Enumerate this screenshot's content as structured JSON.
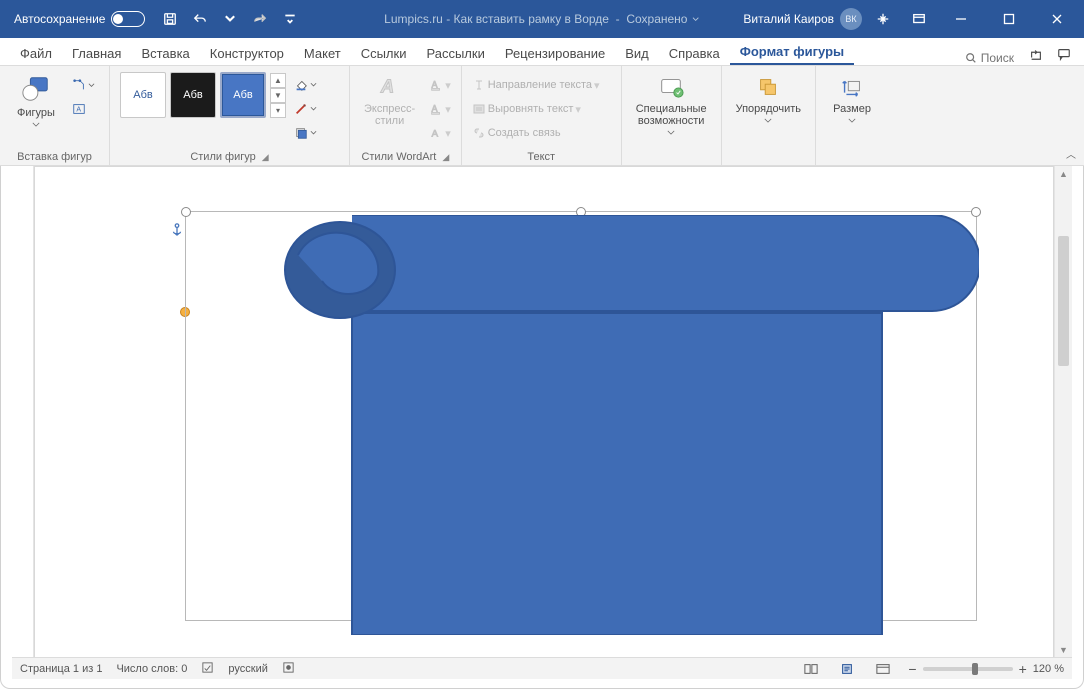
{
  "titlebar": {
    "autosave": "Автосохранение",
    "doc_title": "Lumpics.ru - Как вставить рамку в Ворде",
    "saved": "Сохранено",
    "user": "Виталий Каиров",
    "initials": "ВК"
  },
  "tabs": {
    "file": "Файл",
    "home": "Главная",
    "insert": "Вставка",
    "design": "Конструктор",
    "layout": "Макет",
    "references": "Ссылки",
    "mailings": "Рассылки",
    "review": "Рецензирование",
    "view": "Вид",
    "help": "Справка",
    "shape_format": "Формат фигуры",
    "search": "Поиск"
  },
  "ribbon": {
    "insert_shapes": {
      "label": "Вставка фигур",
      "shapes_btn": "Фигуры"
    },
    "shape_styles": {
      "label": "Стили фигур",
      "preset": "Абв"
    },
    "wordart_styles": {
      "label": "Стили WordArt",
      "quick_styles": "Экспресс-\nстили"
    },
    "text": {
      "label": "Текст",
      "direction": "Направление текста",
      "align": "Выровнять текст",
      "link": "Создать связь"
    },
    "accessibility": {
      "label": "Специальные\nвозможности"
    },
    "arrange": {
      "label": "Упорядочить"
    },
    "size": {
      "label": "Размер"
    }
  },
  "status": {
    "page": "Страница 1 из 1",
    "words": "Число слов: 0",
    "lang": "русский",
    "zoom": "120 %"
  },
  "colors": {
    "shape_fill": "#3f6cb5",
    "shape_fill_dark": "#345b99",
    "shape_stroke": "#2e5597"
  }
}
